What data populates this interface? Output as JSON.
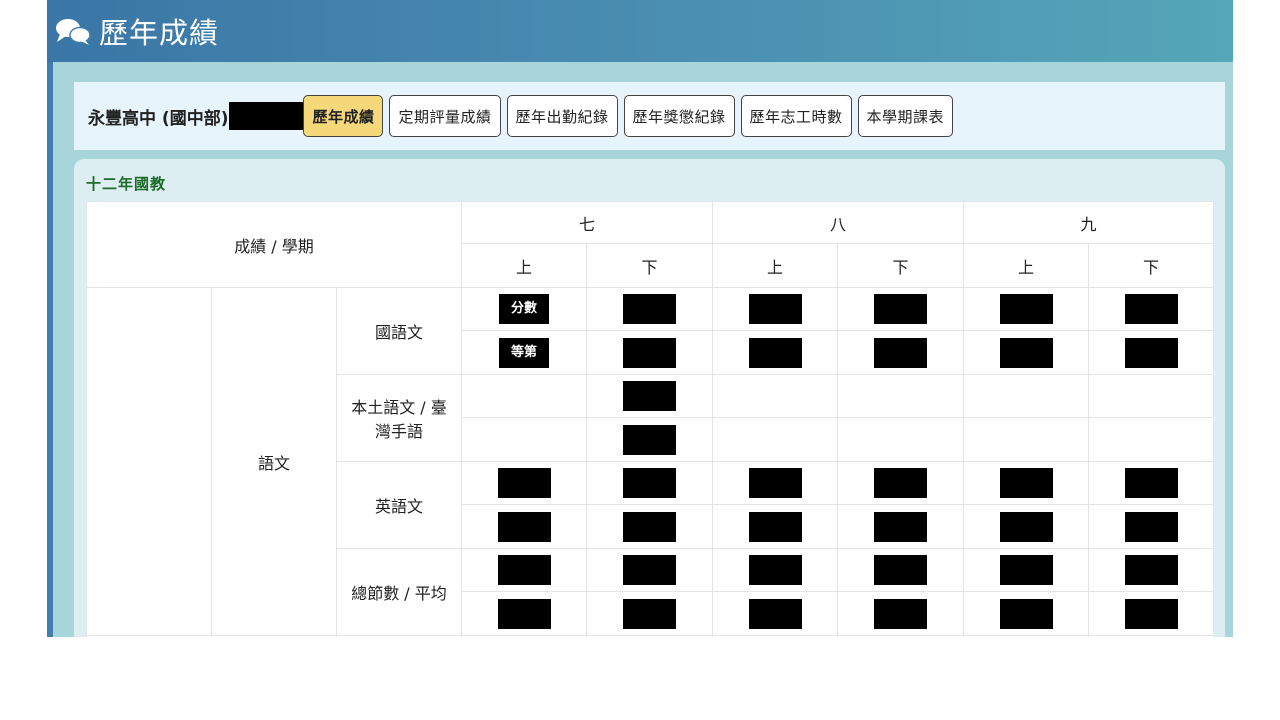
{
  "header": {
    "title": "歷年成績",
    "icon": "comments-icon"
  },
  "toolbar": {
    "school": "永豐高中 (國中部)",
    "tabs": [
      "歷年成績",
      "定期評量成績",
      "歷年出勤紀錄",
      "歷年獎懲紀錄",
      "歷年志工時數",
      "本學期課表"
    ],
    "active_tab": "歷年成績"
  },
  "section": {
    "title": "十二年國教"
  },
  "table": {
    "corner_header": "成績 / 學期",
    "grades": [
      "七",
      "八",
      "九"
    ],
    "terms": [
      "上",
      "下",
      "上",
      "下",
      "上",
      "下"
    ],
    "domain": "語文",
    "subjects": [
      "國語文",
      "本土語文 / 臺灣手語",
      "英語文",
      "總節數 / 平均"
    ],
    "row_labels": [
      "分數",
      "等第"
    ]
  },
  "colors": {
    "header_start": "#3a76a6",
    "header_end": "#55a6b8",
    "frame_bg": "#a7d5da",
    "active_tab": "#f5d879",
    "section_title": "#1d6b2b"
  }
}
